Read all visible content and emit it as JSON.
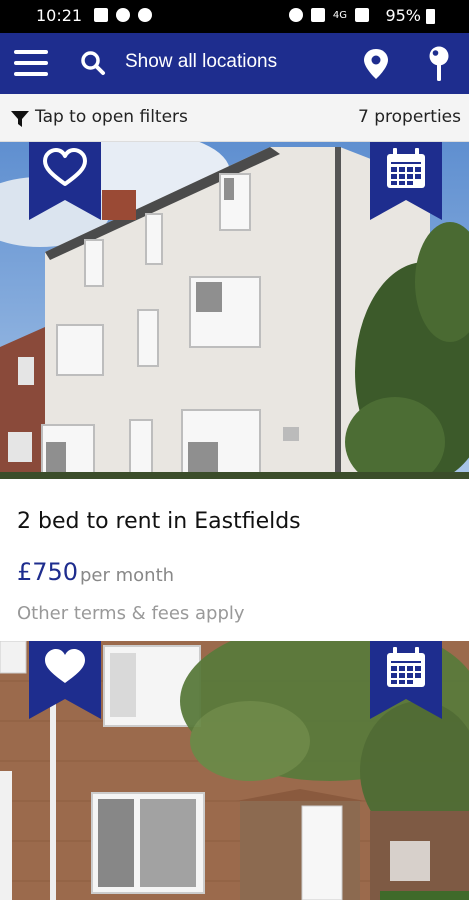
{
  "status_bar": {
    "time": "10:21",
    "battery": "95%",
    "network": "4G"
  },
  "app_bar": {
    "menu_icon": "hamburger-menu-icon",
    "search_icon": "search-icon",
    "title": "Show all locations",
    "map_icon": "map-pin-icon",
    "saved_icon": "push-pin-icon",
    "color": "#1e2d8e"
  },
  "filter_bar": {
    "label": "Tap to open filters",
    "count": "7 properties"
  },
  "listings": [
    {
      "headline": "2 bed to rent in Eastfields",
      "price": "£750",
      "period": "per month",
      "terms": "Other terms & fees apply",
      "favourite_icon": "heart-outline-icon",
      "viewing_icon": "calendar-icon"
    },
    {
      "favourite_icon": "heart-filled-icon",
      "viewing_icon": "calendar-icon"
    }
  ]
}
